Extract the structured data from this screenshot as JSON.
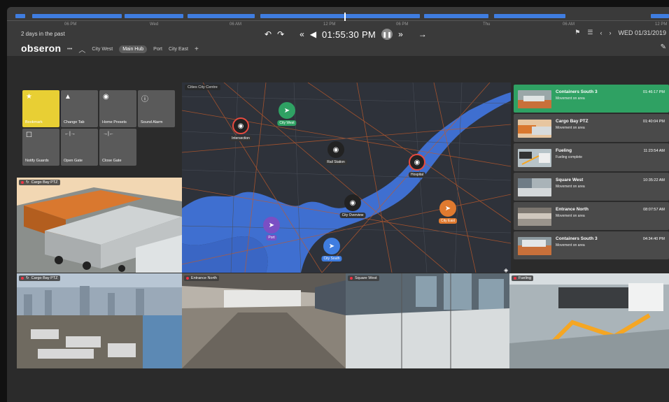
{
  "timeline": {
    "labels": [
      "06 PM",
      "Wed",
      "06 AM",
      "12 PM",
      "06 PM",
      "Thu",
      "06 AM",
      "12 PM"
    ],
    "cursor_position": 0.5
  },
  "header": {
    "past_label": "2 days in the past",
    "time": "01:55:30 PM",
    "date": "WED 01/31/2019"
  },
  "logo": "obseron",
  "nav": {
    "more": "•••",
    "tabs": [
      "City West",
      "Main Hub",
      "Port",
      "City East"
    ],
    "active_tab": "Main Hub",
    "add": "+"
  },
  "tiles": [
    {
      "label": "Bookmark",
      "icon": "star-icon",
      "glyph": "★"
    },
    {
      "label": "Change Tab",
      "icon": "triangle-icon",
      "glyph": "▲"
    },
    {
      "label": "Home Presets",
      "icon": "camera-icon",
      "glyph": "◉"
    },
    {
      "label": "Sound Alarm",
      "icon": "alert-icon",
      "glyph": "ⓘ"
    },
    {
      "label": "Notify Guards",
      "icon": "square-icon",
      "glyph": "☐"
    },
    {
      "label": "Open Gate",
      "icon": "open-gate-icon",
      "glyph": "←|→"
    },
    {
      "label": "Close Gate",
      "icon": "close-gate-icon",
      "glyph": "→|←"
    }
  ],
  "cameras": {
    "cargo_bay_top": "Cargo Bay PTZ",
    "cargo_bay_bottom": "Cargo Bay PTZ",
    "entrance_north": "Entrance North",
    "square_west": "Square West",
    "fueling": "Fueling"
  },
  "map": {
    "breadcrumb": "Cities  City Centre",
    "pins": [
      {
        "label": "City West",
        "color": "#2fa163",
        "glyph": "➤"
      },
      {
        "label": "Intersection",
        "color": "#222222",
        "ring": "#e84a3f",
        "glyph": "◉"
      },
      {
        "label": "Rail Station",
        "color": "#222222",
        "glyph": "◉"
      },
      {
        "label": "Hospital",
        "color": "#222222",
        "ring": "#e84a3f",
        "glyph": "◉"
      },
      {
        "label": "City Overview",
        "color": "#222222",
        "glyph": "◉"
      },
      {
        "label": "City East",
        "color": "#e07a2f",
        "glyph": "➤"
      },
      {
        "label": "Port",
        "color": "#7a4fc4",
        "glyph": "➤"
      },
      {
        "label": "City South",
        "color": "#3f7de0",
        "glyph": "➤"
      }
    ]
  },
  "events": [
    {
      "title": "Containers South 3",
      "sub": "Movement on area",
      "time": "01:46:17 PM"
    },
    {
      "title": "Cargo Bay PTZ",
      "sub": "Movement on area",
      "time": "01:40:04 PM"
    },
    {
      "title": "Fueling",
      "sub": "Fueling complete",
      "time": "11:23:54 AM"
    },
    {
      "title": "Square West",
      "sub": "Movement on area",
      "time": "10:35:22 AM"
    },
    {
      "title": "Entrance North",
      "sub": "Movement on area",
      "time": "08:07:57 AM"
    },
    {
      "title": "Containers South 3",
      "sub": "Movement on area",
      "time": "04:34:40 PM"
    }
  ],
  "colors": {
    "accent": "#3f7de0",
    "active_event": "#2fa163",
    "bookmark": "#e8cf34",
    "alert": "#e84a3f"
  }
}
